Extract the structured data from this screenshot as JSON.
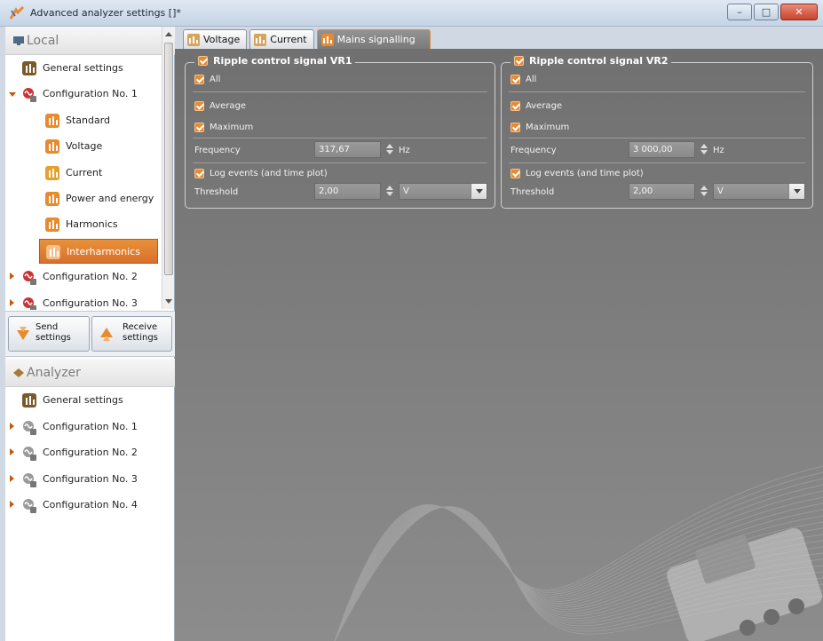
{
  "window": {
    "title": "Advanced analyzer settings []*",
    "minimize_glyph": "–",
    "maximize_glyph": "□",
    "close_glyph": "✕"
  },
  "local_panel": {
    "title": "Local",
    "items": [
      {
        "label": "General settings",
        "icon": "gear-settings-icon",
        "expand": "none"
      },
      {
        "label": "Configuration No. 1",
        "icon": "configuration-1-icon",
        "expand": "expanded"
      },
      {
        "label": "Standard",
        "icon": "standard-icon",
        "expand": "none"
      },
      {
        "label": "Voltage",
        "icon": "voltage-icon",
        "expand": "none"
      },
      {
        "label": "Current",
        "icon": "current-icon",
        "expand": "none"
      },
      {
        "label": "Power and energy",
        "icon": "power-energy-icon",
        "expand": "none"
      },
      {
        "label": "Harmonics",
        "icon": "harmonics-icon",
        "expand": "none"
      },
      {
        "label": "Interharmonics",
        "icon": "interharmonics-icon",
        "expand": "none",
        "selected": true
      },
      {
        "label": "Configuration No. 2",
        "icon": "configuration-2-icon",
        "expand": "collapsed"
      },
      {
        "label": "Configuration No. 3",
        "icon": "configuration-3-icon",
        "expand": "collapsed"
      }
    ]
  },
  "actions": {
    "send_line1": "Send",
    "send_line2": "settings",
    "receive_line1": "Receive",
    "receive_line2": "settings"
  },
  "analyzer_panel": {
    "title": "Analyzer",
    "items": [
      {
        "label": "General settings",
        "icon": "gear-settings-icon"
      },
      {
        "label": "Configuration No. 1",
        "icon": "configuration-1-icon"
      },
      {
        "label": "Configuration No. 2",
        "icon": "configuration-2-icon"
      },
      {
        "label": "Configuration No. 3",
        "icon": "configuration-3-icon"
      },
      {
        "label": "Configuration No. 4",
        "icon": "configuration-4-icon"
      }
    ]
  },
  "tabs": [
    {
      "label": "Voltage",
      "active": false
    },
    {
      "label": "Current",
      "active": false
    },
    {
      "label": "Mains signalling",
      "active": true
    }
  ],
  "vr1": {
    "title": "Ripple control signal VR1",
    "all": "All",
    "average": "Average",
    "maximum": "Maximum",
    "frequency_label": "Frequency",
    "frequency_value": "317,67",
    "frequency_unit": "Hz",
    "log_events": "Log events (and time plot)",
    "threshold_label": "Threshold",
    "threshold_value": "2,00",
    "threshold_unit": "V"
  },
  "vr2": {
    "title": "Ripple control signal VR2",
    "all": "All",
    "average": "Average",
    "maximum": "Maximum",
    "frequency_label": "Frequency",
    "frequency_value": "3 000,00",
    "frequency_unit": "Hz",
    "log_events": "Log events (and time plot)",
    "threshold_label": "Threshold",
    "threshold_value": "2,00",
    "threshold_unit": "V"
  },
  "colors": {
    "accent": "#e88a2d",
    "main_bg": "#7a7a7a",
    "selected_item": "#d9702a"
  }
}
